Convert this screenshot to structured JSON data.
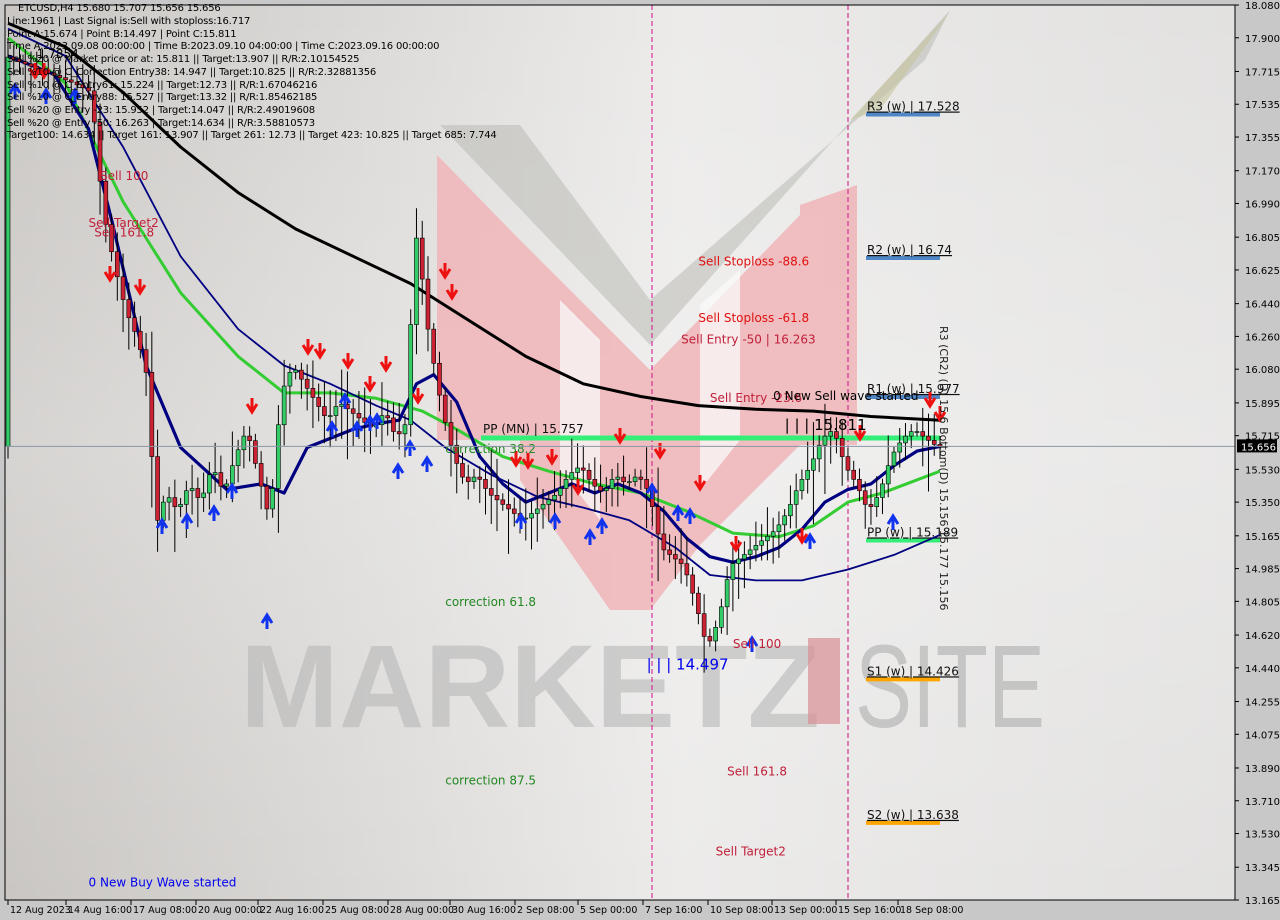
{
  "header": {
    "symbol_line": "ETCUSD,H4  15.680 15.707 15.656 15.656",
    "info_lines": [
      "Line:1961 | Last Signal is:Sell with stoploss:16.717",
      "Point A:15.674 | Point B:14.497 | Point C:15.811",
      "Time A:2023.09.08 00:00:00 | Time B:2023.09.10 04:00:00 | Time C:2023.09.16 00:00:00",
      "Sell %20 @ Market price or at: 15.811 || Target:13.907 || R/R:2.10154525",
      "Sell %10 @ C_Correction Entry38: 14.947 || Target:10.825 || R/R:2.32881356",
      "Sell %10 @ C_Entry61: 15.224 || Target:12.73 || R/R:1.67046216",
      "Sell %10 @ C_Entry88: 15.527 || Target:13.32 || R/R:1.85462185",
      "Sell %20 @ Entry -23: 15.952 | Target:14.047 || R/R:2.49019608",
      "Sell %20 @ Entry -50: 16.263 | Target:14.634 || R/R:3.58810573",
      "Target100: 14.634 || Target 161: 13.907 || Target 261: 12.73 || Target 423: 10.825 || Target 685: 7.744"
    ]
  },
  "chart_data": {
    "type": "candlestick",
    "title": "ETCUSD,H4",
    "ylim": [
      13.165,
      18.08
    ],
    "current_price": 15.656,
    "y_ticks": [
      "18.080",
      "17.900",
      "17.715",
      "17.535",
      "17.355",
      "17.170",
      "16.990",
      "16.805",
      "16.625",
      "16.440",
      "16.260",
      "16.080",
      "15.895",
      "15.715",
      "15.530",
      "15.350",
      "15.165",
      "14.985",
      "14.805",
      "14.620",
      "14.440",
      "14.255",
      "14.075",
      "13.890",
      "13.710",
      "13.530",
      "13.345",
      "13.165"
    ],
    "x_ticks": [
      "12 Aug 2023",
      "14 Aug 16:00",
      "17 Aug 08:00",
      "20 Aug 00:00",
      "22 Aug 16:00",
      "25 Aug 08:00",
      "28 Aug 00:00",
      "30 Aug 16:00",
      "2 Sep 08:00",
      "5 Sep 00:00",
      "7 Sep 16:00",
      "10 Sep 08:00",
      "13 Sep 00:00",
      "15 Sep 16:00",
      "18 Sep 08:00"
    ],
    "price_path": [
      [
        0,
        17.8
      ],
      [
        4,
        17.75
      ],
      [
        8,
        17.7
      ],
      [
        12,
        17.65
      ],
      [
        15,
        17.6
      ],
      [
        17,
        16.95
      ],
      [
        19,
        16.65
      ],
      [
        21,
        16.4
      ],
      [
        23,
        16.25
      ],
      [
        25,
        16.0
      ],
      [
        26,
        15.2
      ],
      [
        28,
        15.4
      ],
      [
        30,
        15.3
      ],
      [
        32,
        15.45
      ],
      [
        34,
        15.35
      ],
      [
        36,
        15.55
      ],
      [
        38,
        15.4
      ],
      [
        40,
        15.6
      ],
      [
        42,
        15.75
      ],
      [
        44,
        15.5
      ],
      [
        46,
        15.25
      ],
      [
        47,
        15.6
      ],
      [
        48,
        15.95
      ],
      [
        50,
        16.1
      ],
      [
        52,
        16.0
      ],
      [
        54,
        15.9
      ],
      [
        56,
        15.8
      ],
      [
        58,
        15.9
      ],
      [
        60,
        15.85
      ],
      [
        62,
        15.8
      ],
      [
        64,
        15.75
      ],
      [
        66,
        15.85
      ],
      [
        68,
        15.7
      ],
      [
        70,
        15.8
      ],
      [
        71,
        16.85
      ],
      [
        72,
        16.75
      ],
      [
        73,
        16.4
      ],
      [
        74,
        16.2
      ],
      [
        76,
        15.85
      ],
      [
        78,
        15.6
      ],
      [
        80,
        15.45
      ],
      [
        82,
        15.5
      ],
      [
        84,
        15.4
      ],
      [
        86,
        15.35
      ],
      [
        88,
        15.3
      ],
      [
        90,
        15.25
      ],
      [
        92,
        15.3
      ],
      [
        94,
        15.35
      ],
      [
        96,
        15.4
      ],
      [
        98,
        15.5
      ],
      [
        100,
        15.55
      ],
      [
        102,
        15.45
      ],
      [
        104,
        15.4
      ],
      [
        106,
        15.5
      ],
      [
        108,
        15.45
      ],
      [
        110,
        15.5
      ],
      [
        112,
        15.4
      ],
      [
        114,
        15.1
      ],
      [
        116,
        15.05
      ],
      [
        118,
        15.0
      ],
      [
        120,
        14.8
      ],
      [
        122,
        14.55
      ],
      [
        124,
        14.7
      ],
      [
        126,
        15.0
      ],
      [
        128,
        15.05
      ],
      [
        130,
        15.1
      ],
      [
        132,
        15.15
      ],
      [
        134,
        15.2
      ],
      [
        136,
        15.3
      ],
      [
        138,
        15.45
      ],
      [
        140,
        15.55
      ],
      [
        142,
        15.7
      ],
      [
        144,
        15.75
      ],
      [
        146,
        15.55
      ],
      [
        148,
        15.45
      ],
      [
        150,
        15.3
      ],
      [
        152,
        15.4
      ],
      [
        154,
        15.6
      ],
      [
        156,
        15.7
      ],
      [
        158,
        15.75
      ],
      [
        160,
        15.7
      ],
      [
        162,
        15.656
      ]
    ],
    "series": [
      {
        "name": "MA long (black)",
        "color": "#000000",
        "points": [
          [
            0,
            17.98
          ],
          [
            10,
            17.85
          ],
          [
            20,
            17.6
          ],
          [
            30,
            17.3
          ],
          [
            40,
            17.05
          ],
          [
            50,
            16.85
          ],
          [
            60,
            16.7
          ],
          [
            70,
            16.55
          ],
          [
            80,
            16.35
          ],
          [
            90,
            16.15
          ],
          [
            100,
            16.0
          ],
          [
            110,
            15.93
          ],
          [
            120,
            15.88
          ],
          [
            130,
            15.86
          ],
          [
            140,
            15.85
          ],
          [
            150,
            15.82
          ],
          [
            162,
            15.8
          ]
        ]
      },
      {
        "name": "MA mid (green)",
        "color": "#33cc33",
        "points": [
          [
            0,
            17.9
          ],
          [
            10,
            17.65
          ],
          [
            20,
            17.0
          ],
          [
            30,
            16.5
          ],
          [
            40,
            16.15
          ],
          [
            48,
            15.95
          ],
          [
            56,
            15.95
          ],
          [
            64,
            15.92
          ],
          [
            72,
            15.85
          ],
          [
            78,
            15.75
          ],
          [
            86,
            15.6
          ],
          [
            94,
            15.52
          ],
          [
            102,
            15.45
          ],
          [
            110,
            15.4
          ],
          [
            118,
            15.3
          ],
          [
            126,
            15.18
          ],
          [
            134,
            15.16
          ],
          [
            140,
            15.22
          ],
          [
            146,
            15.35
          ],
          [
            152,
            15.4
          ],
          [
            162,
            15.52
          ]
        ]
      },
      {
        "name": "MA fast thick (navy)",
        "color": "#000080",
        "points": [
          [
            0,
            17.8
          ],
          [
            8,
            17.7
          ],
          [
            14,
            17.4
          ],
          [
            18,
            16.9
          ],
          [
            24,
            16.1
          ],
          [
            30,
            15.65
          ],
          [
            38,
            15.42
          ],
          [
            44,
            15.45
          ],
          [
            48,
            15.4
          ],
          [
            52,
            15.65
          ],
          [
            56,
            15.7
          ],
          [
            60,
            15.75
          ],
          [
            64,
            15.78
          ],
          [
            68,
            15.8
          ],
          [
            71,
            16.0
          ],
          [
            74,
            16.05
          ],
          [
            78,
            15.9
          ],
          [
            82,
            15.6
          ],
          [
            86,
            15.45
          ],
          [
            90,
            15.35
          ],
          [
            94,
            15.4
          ],
          [
            98,
            15.45
          ],
          [
            102,
            15.4
          ],
          [
            106,
            15.45
          ],
          [
            110,
            15.4
          ],
          [
            114,
            15.3
          ],
          [
            118,
            15.15
          ],
          [
            122,
            15.05
          ],
          [
            126,
            15.02
          ],
          [
            130,
            15.05
          ],
          [
            134,
            15.1
          ],
          [
            138,
            15.2
          ],
          [
            142,
            15.35
          ],
          [
            146,
            15.42
          ],
          [
            150,
            15.45
          ],
          [
            154,
            15.55
          ],
          [
            158,
            15.63
          ],
          [
            162,
            15.656
          ]
        ]
      },
      {
        "name": "MA slow thin (navy)",
        "color": "#000080",
        "points": [
          [
            0,
            17.95
          ],
          [
            10,
            17.8
          ],
          [
            20,
            17.3
          ],
          [
            30,
            16.7
          ],
          [
            40,
            16.3
          ],
          [
            48,
            16.1
          ],
          [
            56,
            16.0
          ],
          [
            64,
            15.88
          ],
          [
            70,
            15.8
          ],
          [
            76,
            15.65
          ],
          [
            84,
            15.5
          ],
          [
            92,
            15.38
          ],
          [
            100,
            15.32
          ],
          [
            108,
            15.25
          ],
          [
            116,
            15.1
          ],
          [
            122,
            14.95
          ],
          [
            130,
            14.92
          ],
          [
            138,
            14.92
          ],
          [
            146,
            14.98
          ],
          [
            154,
            15.06
          ],
          [
            162,
            15.17
          ]
        ]
      }
    ],
    "pivot_levels": [
      {
        "label": "R3 (w) | 17.528",
        "value": 17.528,
        "color": "#4f86c6"
      },
      {
        "label": "R2 (w) | 16.74",
        "value": 16.74,
        "color": "#4f86c6"
      },
      {
        "label": "R1 (w) | 15.977",
        "value": 15.977,
        "color": "#4f86c6"
      },
      {
        "label": "PP (w) | 15.189",
        "value": 15.189,
        "color": "#33ee77"
      },
      {
        "label": "S1 (w) | 14.426",
        "value": 14.426,
        "color": "#ffa500"
      },
      {
        "label": "S2 (w) | 13.638",
        "value": 13.638,
        "color": "#ffa500"
      }
    ],
    "pp_monthly": {
      "label": "PP (MN) | 15.757",
      "value": 15.757,
      "color": "#33ee77"
    },
    "annotations": [
      {
        "text": "Sell 100",
        "color": "#c0203a",
        "x": 16,
        "y": 17.12
      },
      {
        "text": "Sell Target2",
        "color": "#c0203a",
        "x": 14,
        "y": 16.86
      },
      {
        "text": "Sell 161.8",
        "color": "#c0203a",
        "x": 15,
        "y": 16.81
      },
      {
        "text": "Sell Stoploss -88.6",
        "color": "#e01010",
        "x": 120,
        "y": 16.65
      },
      {
        "text": "Sell Stoploss -61.8",
        "color": "#e01010",
        "x": 120,
        "y": 16.34
      },
      {
        "text": "Sell Entry -50 | 16.263",
        "color": "#c0203a",
        "x": 117,
        "y": 16.22
      },
      {
        "text": "Sell Entry -23.6",
        "color": "#c0203a",
        "x": 122,
        "y": 15.9
      },
      {
        "text": "0 New Sell wave started",
        "color": "#000000",
        "x": 133,
        "y": 15.91
      },
      {
        "text": "| | | 15.811",
        "color": "#000000",
        "x": 135,
        "y": 15.745
      },
      {
        "text": "correction 38.2",
        "color": "#228822",
        "x": 76,
        "y": 15.62
      },
      {
        "text": "correction 61.8",
        "color": "#228822",
        "x": 76,
        "y": 14.78
      },
      {
        "text": "correction 87.5",
        "color": "#228822",
        "x": 76,
        "y": 13.8
      },
      {
        "text": "Sell 100",
        "color": "#c0203a",
        "x": 126,
        "y": 14.55
      },
      {
        "text": "| | | 14.497",
        "color": "#0000ee",
        "x": 111,
        "y": 14.43
      },
      {
        "text": "Sell 161.8",
        "color": "#c0203a",
        "x": 125,
        "y": 13.85
      },
      {
        "text": "Sell Target2",
        "color": "#c0203a",
        "x": 123,
        "y": 13.41
      },
      {
        "text": "0 New Buy Wave started",
        "color": "#0000ee",
        "x": 14,
        "y": 13.24
      },
      {
        "text": "1.7854",
        "color": "#000000",
        "x": 5,
        "y": 17.79
      }
    ],
    "vertical_text": "R3 (CR2) (D) 15.6 Bottom(D) 15.156 15.177 15.156",
    "vertical_lines_x": [
      108,
      141
    ],
    "watermark": "MARKETZISITE"
  }
}
